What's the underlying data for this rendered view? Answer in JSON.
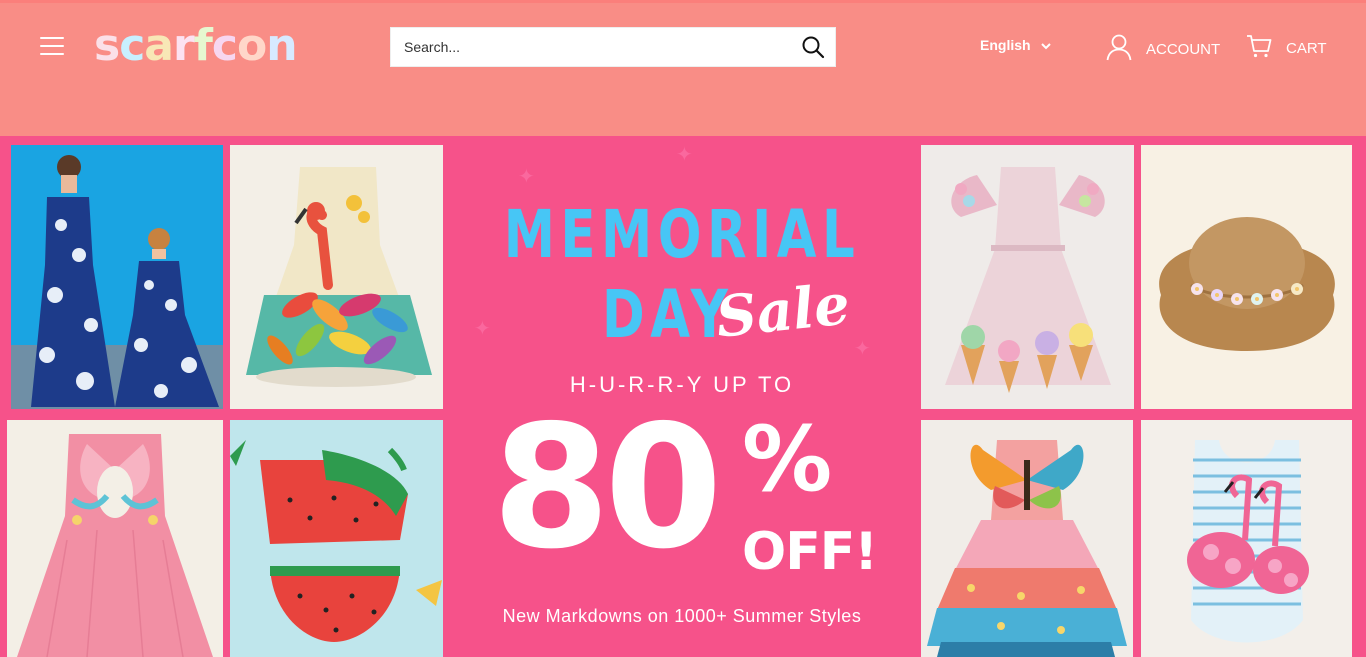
{
  "header": {
    "logo_text": "scarfcon",
    "logo_letters": [
      "s",
      "c",
      "a",
      "r",
      "f",
      "c",
      "o",
      "n"
    ],
    "search": {
      "placeholder": "Search..."
    },
    "language": "English",
    "account_label": "ACCOUNT",
    "cart_label": "CART"
  },
  "hero": {
    "headline_line1": "MEMORIAL",
    "headline_line2": "DAY",
    "headline_script": "Sale",
    "hurry": "H-U-R-R-Y UP TO",
    "discount_number": "80",
    "discount_percent": "%",
    "discount_off": "OFF!",
    "subline": "New Markdowns on 1000+ Summer Styles"
  },
  "colors": {
    "header_bg": "#f98d86",
    "hero_bg": "#f6528a",
    "headline_blue": "#47c6f5"
  },
  "products": [
    {
      "name": "mother-daughter-floral-maxi-dress"
    },
    {
      "name": "flamingo-feather-dress"
    },
    {
      "name": "ice-cream-tulle-dress"
    },
    {
      "name": "flower-straw-sun-hat"
    },
    {
      "name": "butterfly-back-pink-dress"
    },
    {
      "name": "watermelon-bikini-set"
    },
    {
      "name": "butterfly-layered-tutu-dress"
    },
    {
      "name": "flamingo-striped-swimsuit"
    }
  ]
}
